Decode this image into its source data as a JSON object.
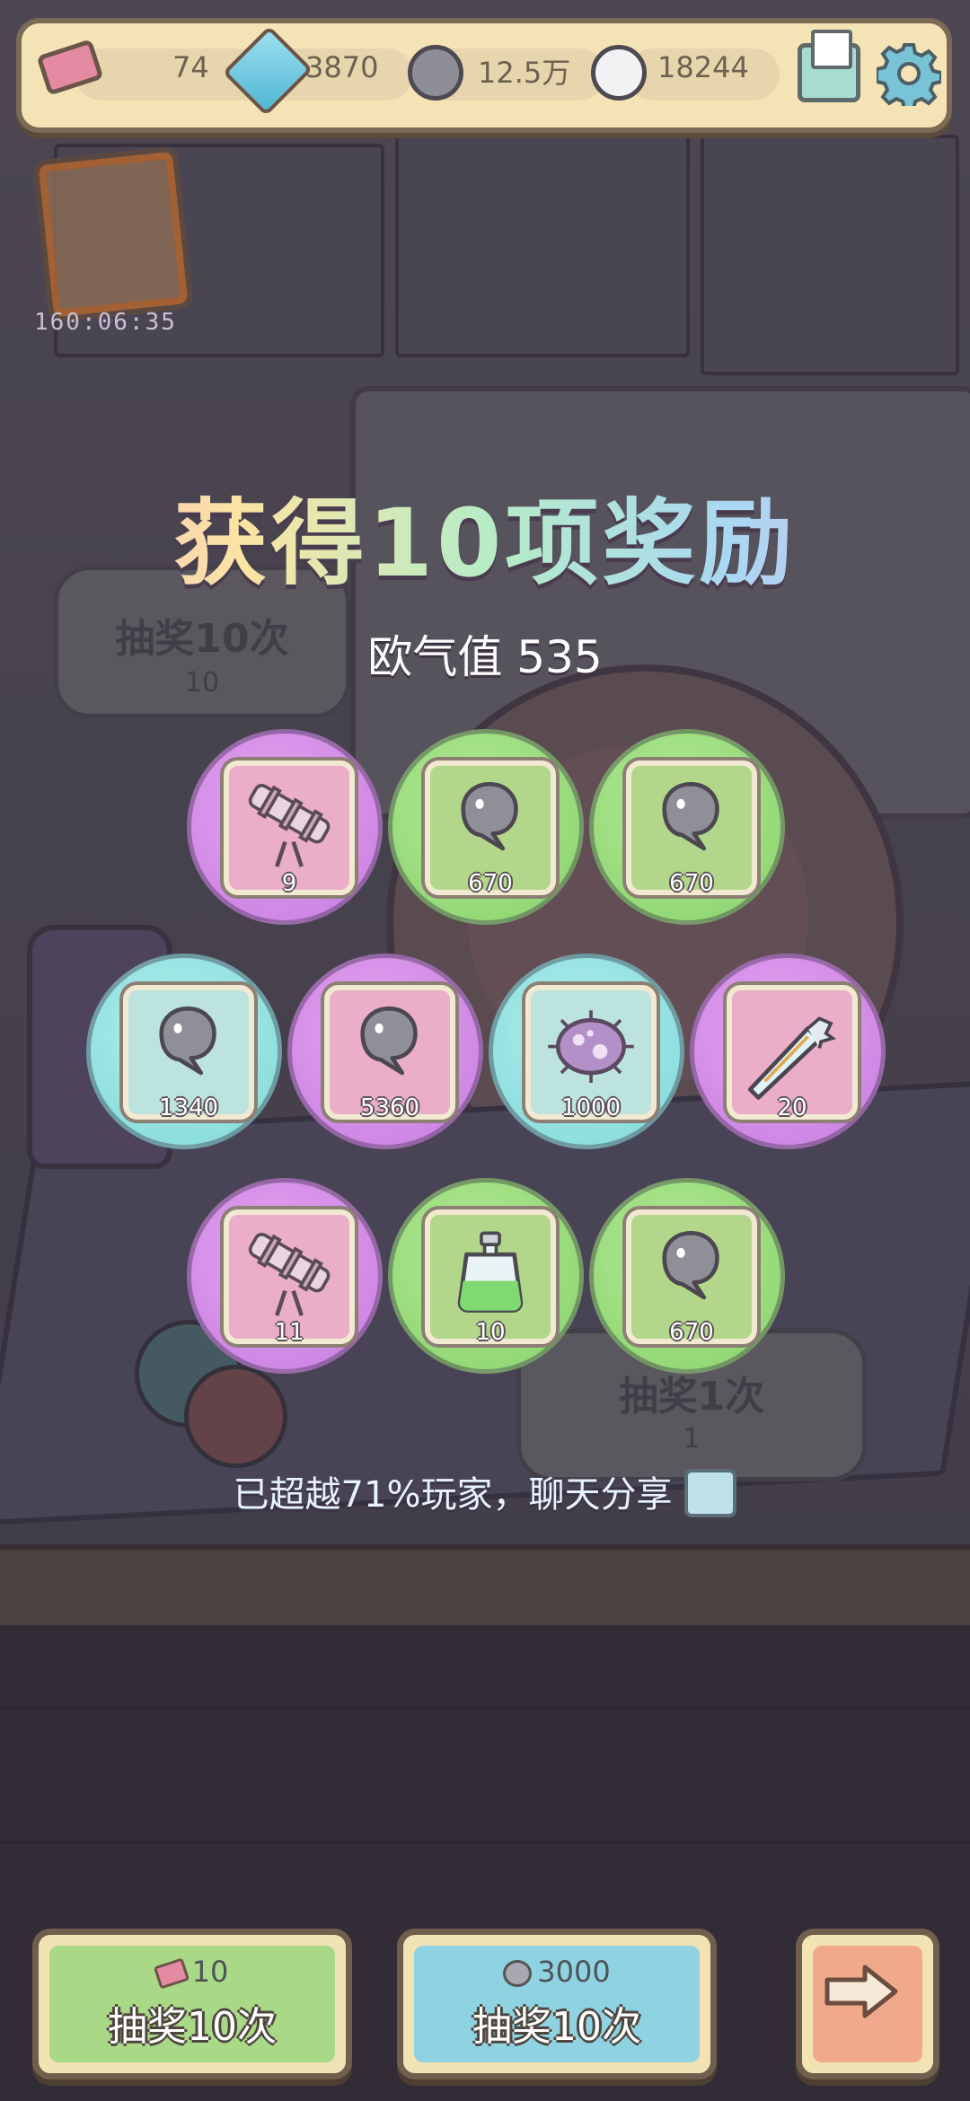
{
  "topbar": {
    "tickets": "74",
    "gems": "3870",
    "gray_bubbles": "12.5万",
    "white_bubbles": "18244",
    "icons": [
      "ticket-icon",
      "gem-icon",
      "gray-bubble-icon",
      "white-bubble-icon",
      "mail-icon",
      "gear-icon"
    ]
  },
  "event": {
    "timer": "160:06:35"
  },
  "background_buttons": {
    "draw10": {
      "label": "抽奖10次",
      "cost": "10"
    },
    "draw1": {
      "label": "抽奖1次",
      "cost": "1"
    }
  },
  "result": {
    "title": "获得10项奖励",
    "luck": "欧气值 535",
    "rewards": [
      {
        "item": "telescope",
        "qty": "9",
        "color": "purple"
      },
      {
        "item": "gray-bubble",
        "qty": "670",
        "color": "green"
      },
      {
        "item": "gray-bubble",
        "qty": "670",
        "color": "green"
      },
      {
        "item": "gray-bubble",
        "qty": "1340",
        "color": "cyan"
      },
      {
        "item": "gray-bubble",
        "qty": "5360",
        "color": "purple"
      },
      {
        "item": "microbe",
        "qty": "1000",
        "color": "cyan"
      },
      {
        "item": "crystal-knife",
        "qty": "20",
        "color": "purple"
      },
      {
        "item": "telescope",
        "qty": "11",
        "color": "purple"
      },
      {
        "item": "potion-bottle",
        "qty": "10",
        "color": "green"
      },
      {
        "item": "gray-bubble",
        "qty": "670",
        "color": "green"
      }
    ],
    "share_text": "已超越71%玩家，聊天分享"
  },
  "buttons": {
    "draw10_ticket": {
      "cost": "10",
      "label": "抽奖10次"
    },
    "draw10_bubble": {
      "cost": "3000",
      "label": "抽奖10次"
    },
    "next": {
      "icon": "arrow-right-icon"
    }
  },
  "colors": {
    "purple": "#d08ae6",
    "green": "#92d875",
    "cyan": "#8ee0de",
    "panel": "#f4e3b5"
  }
}
